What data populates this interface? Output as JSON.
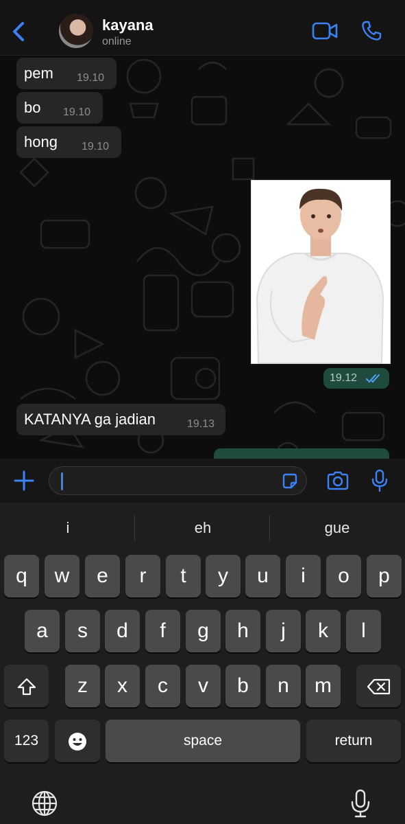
{
  "header": {
    "contact_name": "kayana",
    "status": "online",
    "icons": [
      "back-chevron-icon",
      "video-call-icon",
      "voice-call-icon"
    ]
  },
  "messages": [
    {
      "direction": "incoming",
      "text": "pem",
      "time": "19.10"
    },
    {
      "direction": "incoming",
      "text": "bo",
      "time": "19.10"
    },
    {
      "direction": "incoming",
      "text": "hong",
      "time": "19.10"
    },
    {
      "direction": "outgoing",
      "type": "image",
      "time": "19.12",
      "status_icon": "double-check-read-icon"
    },
    {
      "direction": "incoming",
      "text": "KATANYA ga jadian",
      "time": "19.13"
    }
  ],
  "input_bar": {
    "value": "",
    "icons": [
      "plus-icon",
      "sticker-icon",
      "camera-icon",
      "microphone-icon"
    ]
  },
  "keyboard": {
    "suggestions": [
      "i",
      "eh",
      "gue"
    ],
    "row1": [
      "q",
      "w",
      "e",
      "r",
      "t",
      "y",
      "u",
      "i",
      "o",
      "p"
    ],
    "row2": [
      "a",
      "s",
      "d",
      "f",
      "g",
      "h",
      "j",
      "k",
      "l"
    ],
    "row3": [
      "z",
      "x",
      "c",
      "v",
      "b",
      "n",
      "m"
    ],
    "numbers_key": "123",
    "space_key": "space",
    "return_key": "return",
    "icons": [
      "shift-icon",
      "backspace-icon",
      "emoji-icon",
      "globe-icon",
      "dictation-icon"
    ]
  },
  "colors": {
    "accent": "#3b82f6",
    "incoming_bubble": "#262626",
    "outgoing_bubble": "#1f4a3e",
    "keyboard_bg": "#1e1e1e"
  }
}
